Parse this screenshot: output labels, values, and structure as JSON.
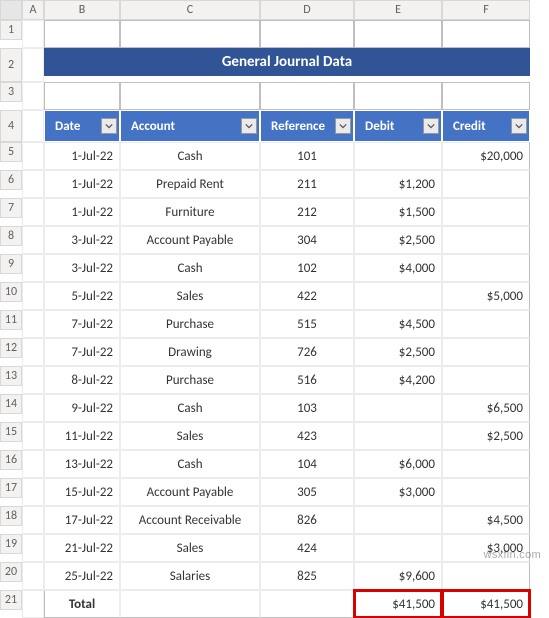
{
  "columns": [
    "A",
    "B",
    "C",
    "D",
    "E",
    "F"
  ],
  "row_numbers": [
    1,
    2,
    3,
    4,
    5,
    6,
    7,
    8,
    9,
    10,
    11,
    12,
    13,
    14,
    15,
    16,
    17,
    18,
    19,
    20,
    21
  ],
  "title": "General Journal Data",
  "headers": {
    "date": "Date",
    "account": "Account",
    "reference": "Reference",
    "debit": "Debit",
    "credit": "Credit"
  },
  "rows": [
    {
      "date": "1-Jul-22",
      "account": "Cash",
      "reference": "101",
      "debit": "",
      "credit": "$20,000"
    },
    {
      "date": "1-Jul-22",
      "account": "Prepaid Rent",
      "reference": "211",
      "debit": "$1,200",
      "credit": ""
    },
    {
      "date": "1-Jul-22",
      "account": "Furniture",
      "reference": "212",
      "debit": "$1,500",
      "credit": ""
    },
    {
      "date": "3-Jul-22",
      "account": "Account Payable",
      "reference": "304",
      "debit": "$2,500",
      "credit": ""
    },
    {
      "date": "3-Jul-22",
      "account": "Cash",
      "reference": "102",
      "debit": "$4,000",
      "credit": ""
    },
    {
      "date": "5-Jul-22",
      "account": "Sales",
      "reference": "422",
      "debit": "",
      "credit": "$5,000"
    },
    {
      "date": "7-Jul-22",
      "account": "Purchase",
      "reference": "515",
      "debit": "$4,500",
      "credit": ""
    },
    {
      "date": "7-Jul-22",
      "account": "Drawing",
      "reference": "726",
      "debit": "$2,500",
      "credit": ""
    },
    {
      "date": "8-Jul-22",
      "account": "Purchase",
      "reference": "516",
      "debit": "$4,200",
      "credit": ""
    },
    {
      "date": "9-Jul-22",
      "account": "Cash",
      "reference": "103",
      "debit": "",
      "credit": "$6,500"
    },
    {
      "date": "11-Jul-22",
      "account": "Sales",
      "reference": "423",
      "debit": "",
      "credit": "$2,500"
    },
    {
      "date": "13-Jul-22",
      "account": "Cash",
      "reference": "104",
      "debit": "$6,000",
      "credit": ""
    },
    {
      "date": "15-Jul-22",
      "account": "Account Payable",
      "reference": "305",
      "debit": "$3,000",
      "credit": ""
    },
    {
      "date": "17-Jul-22",
      "account": "Account Receivable",
      "reference": "826",
      "debit": "",
      "credit": "$4,500"
    },
    {
      "date": "21-Jul-22",
      "account": "Sales",
      "reference": "424",
      "debit": "",
      "credit": "$3,000"
    },
    {
      "date": "25-Jul-22",
      "account": "Salaries",
      "reference": "825",
      "debit": "$9,600",
      "credit": ""
    }
  ],
  "totals": {
    "label": "Total",
    "debit": "$41,500",
    "credit": "$41,500"
  },
  "watermark": "wsxfin.com",
  "chart_data": {
    "type": "table",
    "title": "General Journal Data",
    "columns": [
      "Date",
      "Account",
      "Reference",
      "Debit",
      "Credit"
    ],
    "rows": [
      [
        "1-Jul-22",
        "Cash",
        101,
        null,
        20000
      ],
      [
        "1-Jul-22",
        "Prepaid Rent",
        211,
        1200,
        null
      ],
      [
        "1-Jul-22",
        "Furniture",
        212,
        1500,
        null
      ],
      [
        "3-Jul-22",
        "Account Payable",
        304,
        2500,
        null
      ],
      [
        "3-Jul-22",
        "Cash",
        102,
        4000,
        null
      ],
      [
        "5-Jul-22",
        "Sales",
        422,
        null,
        5000
      ],
      [
        "7-Jul-22",
        "Purchase",
        515,
        4500,
        null
      ],
      [
        "7-Jul-22",
        "Drawing",
        726,
        2500,
        null
      ],
      [
        "8-Jul-22",
        "Purchase",
        516,
        4200,
        null
      ],
      [
        "9-Jul-22",
        "Cash",
        103,
        null,
        6500
      ],
      [
        "11-Jul-22",
        "Sales",
        423,
        null,
        2500
      ],
      [
        "13-Jul-22",
        "Cash",
        104,
        6000,
        null
      ],
      [
        "15-Jul-22",
        "Account Payable",
        305,
        3000,
        null
      ],
      [
        "17-Jul-22",
        "Account Receivable",
        826,
        null,
        4500
      ],
      [
        "21-Jul-22",
        "Sales",
        424,
        null,
        3000
      ],
      [
        "25-Jul-22",
        "Salaries",
        825,
        9600,
        null
      ]
    ],
    "totals": {
      "debit": 41500,
      "credit": 41500
    }
  }
}
